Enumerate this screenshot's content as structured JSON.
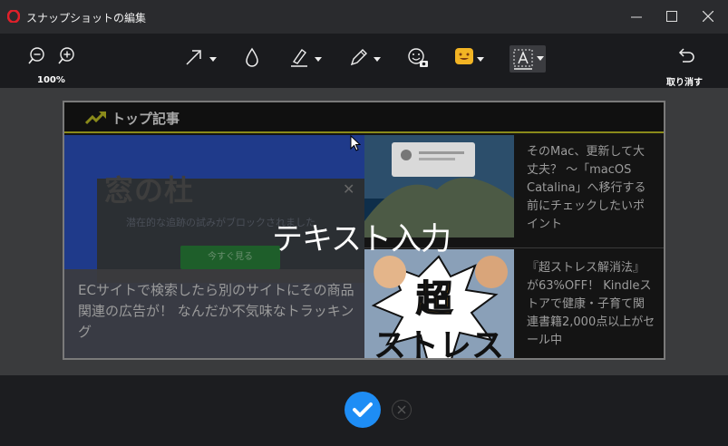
{
  "window": {
    "title": "スナップショットの編集",
    "minimize_icon": "minimize-icon",
    "maximize_icon": "maximize-icon",
    "close_icon": "close-icon"
  },
  "toolbar": {
    "zoom_out_icon": "zoom-out-icon",
    "zoom_in_icon": "zoom-in-icon",
    "zoom_level": "100%",
    "tools": [
      {
        "name": "arrow",
        "icon": "arrow-tool-icon",
        "has_dropdown": true
      },
      {
        "name": "blur",
        "icon": "blur-drop-icon",
        "has_dropdown": false
      },
      {
        "name": "highlighter",
        "icon": "highlighter-icon",
        "has_dropdown": true
      },
      {
        "name": "pen",
        "icon": "pen-icon",
        "has_dropdown": true
      },
      {
        "name": "sticker",
        "icon": "sticker-emoji-icon",
        "has_dropdown": false
      },
      {
        "name": "emoji",
        "icon": "emoji-icon",
        "has_dropdown": true
      },
      {
        "name": "text",
        "icon": "text-tool-icon",
        "has_dropdown": true,
        "active": true
      }
    ],
    "undo_label": "取り消す",
    "undo_icon": "undo-icon"
  },
  "snapshot": {
    "header_title": "トップ記事",
    "hero": {
      "brand": "窓の杜",
      "subtext": "潜在的な追跡の試みがブロックされました",
      "button": "今すぐ見る",
      "caption": "ECサイトで検索したら別のサイトにその商品関連の広告が！ なんだか不気味なトラッキング"
    },
    "articles": [
      {
        "text": "そのMac、更新して大丈夫？ ～「macOS Catalina」へ移行する前にチェックしたいポイント"
      },
      {
        "text": "『超ストレス解消法』が63%OFF！ Kindleストアで健康・子育て関連書籍2,000点以上がセール中"
      }
    ],
    "thumb2_text_top": "超",
    "thumb2_text_bottom": "ストレス"
  },
  "text_input_placeholder": "テキスト入力",
  "footer": {
    "confirm_icon": "checkmark-icon",
    "cancel_icon": "cancel-x-icon"
  },
  "colors": {
    "accent": "#1e8df5",
    "header_rule": "#8a8a1a",
    "logo_red": "#e0202a",
    "emoji_yellow": "#f2b424"
  }
}
